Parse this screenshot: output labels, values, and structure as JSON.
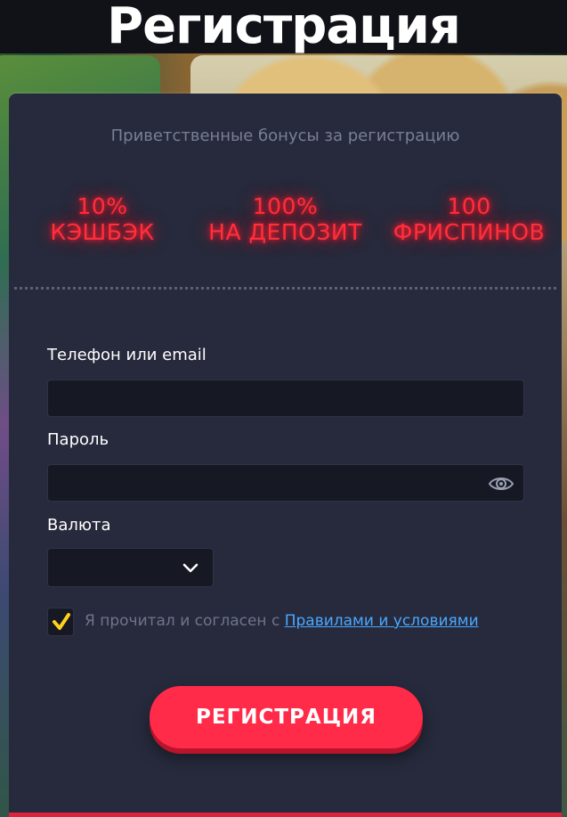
{
  "header": {
    "title": "Регистрация"
  },
  "bonuses": {
    "caption": "Приветственные бонусы за регистрацию",
    "items": [
      {
        "line1": "10%",
        "line2": "КЭШБЭК"
      },
      {
        "line1": "100%",
        "line2": "НА ДЕПОЗИТ"
      },
      {
        "line1": "100",
        "line2": "ФРИСПИНОВ"
      }
    ]
  },
  "form": {
    "login_label": "Телефон или email",
    "login_value": "",
    "password_label": "Пароль",
    "password_value": "",
    "currency_label": "Валюта",
    "currency_value": "",
    "agree_checked": true,
    "agree_text": "Я прочитал и согласен с ",
    "agree_link": "Правилами и условиями",
    "submit_label": "РЕГИСТРАЦИЯ"
  },
  "colors": {
    "accent": "#ff2b49",
    "neon": "#ff2f3c",
    "link": "#4aa8ff",
    "check": "#ffd21a",
    "card": "#262a3c",
    "field": "#161824"
  },
  "icons": {
    "password_toggle": "eye-icon",
    "currency_dropdown": "chevron-down-icon",
    "agree_check": "checkmark-icon"
  }
}
